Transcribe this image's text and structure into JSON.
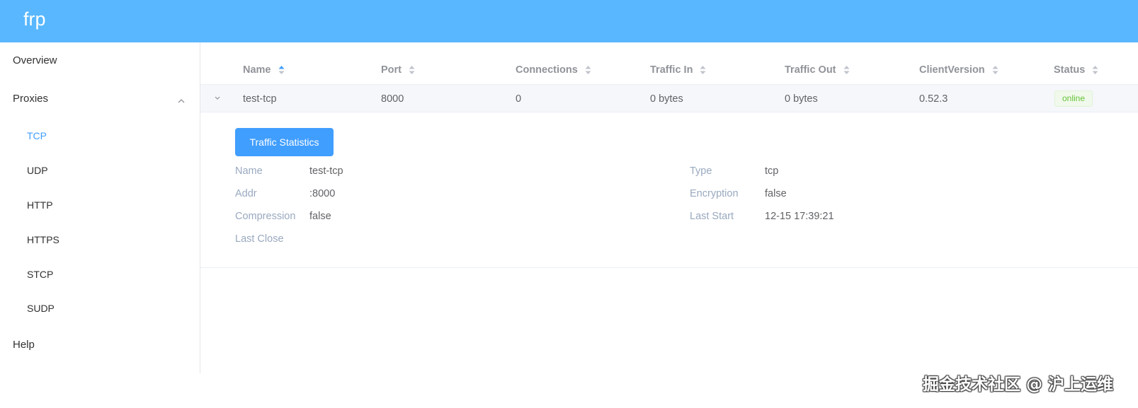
{
  "header": {
    "title": "frp",
    "color": "#58b7ff"
  },
  "sidebar": {
    "items": [
      {
        "label": "Overview"
      },
      {
        "label": "Proxies",
        "expanded": true,
        "icon": "chevron-up-icon"
      },
      {
        "label": "Help"
      }
    ],
    "proxies_submenu": [
      {
        "label": "TCP",
        "active": true
      },
      {
        "label": "UDP"
      },
      {
        "label": "HTTP"
      },
      {
        "label": "HTTPS"
      },
      {
        "label": "STCP"
      },
      {
        "label": "SUDP"
      }
    ]
  },
  "table": {
    "columns": [
      "Name",
      "Port",
      "Connections",
      "Traffic In",
      "Traffic Out",
      "ClientVersion",
      "Status"
    ],
    "sorted_column": "Name",
    "sort_icon": "sort-caret-icon",
    "rows": [
      {
        "name": "test-tcp",
        "port": "8000",
        "connections": "0",
        "traffic_in": "0 bytes",
        "traffic_out": "0 bytes",
        "client_version": "0.52.3",
        "status": "online",
        "expanded": true
      }
    ]
  },
  "details": {
    "button_label": "Traffic Statistics",
    "left": [
      {
        "label": "Name",
        "value": "test-tcp"
      },
      {
        "label": "Addr",
        "value": ":8000"
      },
      {
        "label": "Compression",
        "value": "false"
      },
      {
        "label": "Last Close",
        "value": ""
      }
    ],
    "right": [
      {
        "label": "Type",
        "value": "tcp"
      },
      {
        "label": "Encryption",
        "value": "false"
      },
      {
        "label": "Last Start",
        "value": "12-15 17:39:21"
      }
    ]
  },
  "watermark": "掘金技术社区 @ 沪上运维",
  "colors": {
    "accent": "#409eff",
    "status_online": "#67c23a",
    "label_muted": "#99a9bf"
  }
}
